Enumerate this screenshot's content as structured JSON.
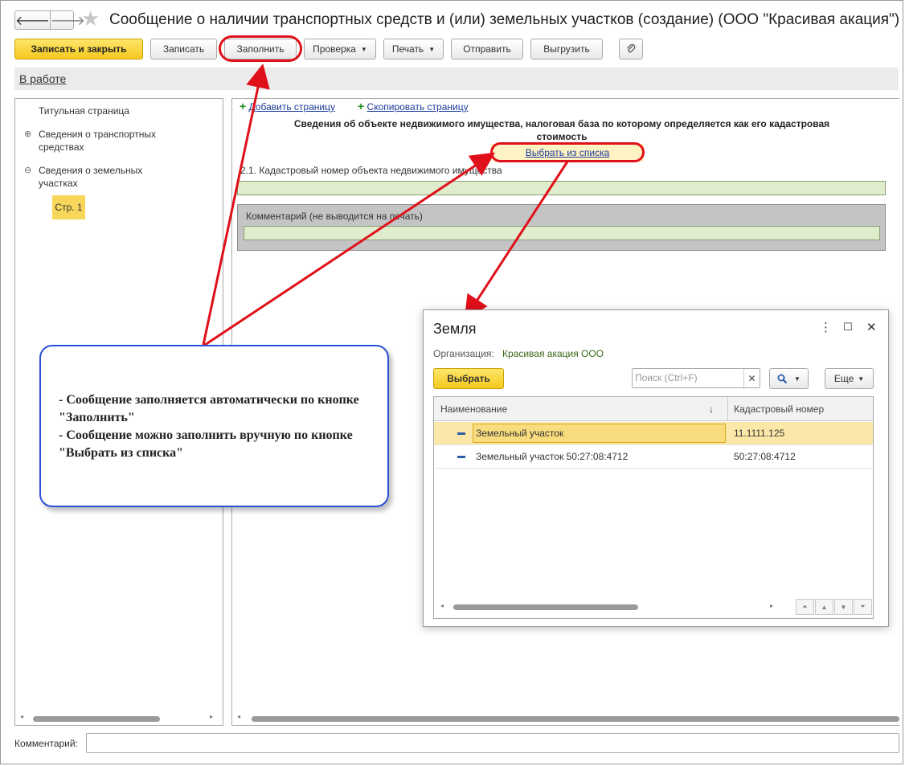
{
  "window": {
    "back_icon": "arrow-left-icon",
    "forward_icon": "arrow-right-icon",
    "favorite_icon": "star-icon",
    "title": "Сообщение о наличии транспортных средств и (или) земельных участков (создание) (ООО \"Красивая акация\")"
  },
  "toolbar": {
    "save_close": "Записать и закрыть",
    "save": "Записать",
    "fill": "Заполнить",
    "check": "Проверка",
    "print": "Печать",
    "send": "Отправить",
    "export": "Выгрузить",
    "attach_icon": "paperclip-icon"
  },
  "status": {
    "link": "В работе"
  },
  "left_panel": {
    "items": [
      {
        "label": "Титульная страница"
      },
      {
        "label": "Сведения о транспортных средствах",
        "toggle": "⊕"
      },
      {
        "label": "Сведения о земельных участках",
        "toggle": "⊖"
      }
    ],
    "page_badge": "Стр. 1"
  },
  "main": {
    "add_page": "Добавить страницу",
    "copy_page": "Скопировать страницу",
    "section_title": "Сведения об объекте недвижимого имущества, налоговая база по которому определяется как его кадастровая стоимость",
    "select_from_list": "Выбрать из списка",
    "cadastral_label": "2.1. Кадастровый номер объекта недвижимого имущества",
    "comment_label": "Комментарий (не выводится на печать)"
  },
  "footer": {
    "comment_label": "Комментарий:"
  },
  "callout": {
    "text": "- Сообщение заполняется автоматически по кнопке \"Заполнить\"\n- Сообщение можно заполнить вручную по кнопке \"Выбрать из списка\""
  },
  "dialog": {
    "title": "Земля",
    "org_label": "Организация:",
    "org_value": "Красивая акация ООО",
    "select_button": "Выбрать",
    "search_placeholder": "Поиск (Ctrl+F)",
    "more_button": "Еще",
    "columns": [
      "Наименование",
      "Кадастровый номер"
    ],
    "sort_indicator": "↓",
    "rows": [
      {
        "name": "Земельный участок",
        "cadastral": "11.1111.125",
        "selected": true
      },
      {
        "name": "Земельный участок  50:27:08:4712",
        "cadastral": "50:27:08:4712",
        "selected": false
      }
    ]
  },
  "colors": {
    "accent_yellow": "#f4c81e",
    "annotation_red": "#e0101a",
    "callout_blue": "#2b4fd6",
    "field_green": "#dfeccd",
    "link_blue": "#1a3a9c"
  }
}
